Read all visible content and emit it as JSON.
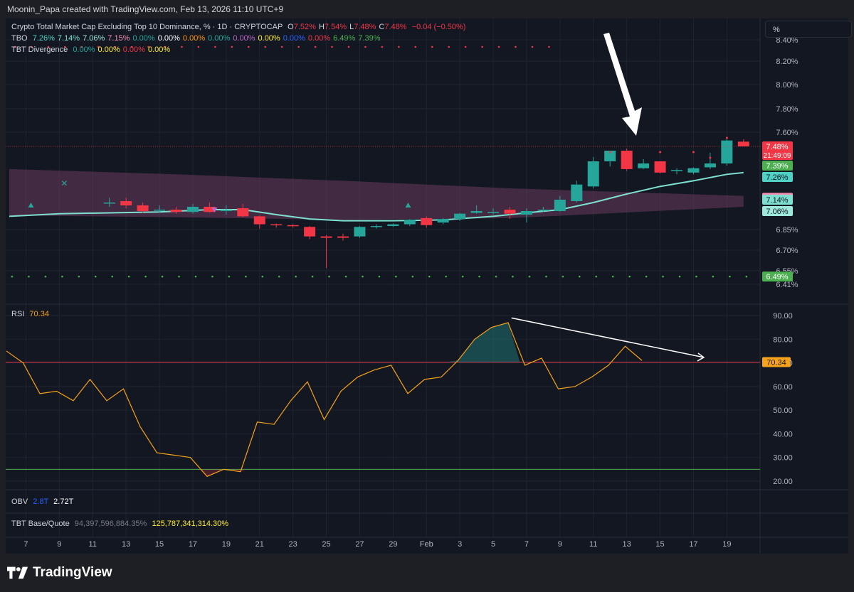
{
  "header": {
    "attribution": "Moonin_Papa created with TradingView.com, Feb 13, 2026 11:10 UTC+9"
  },
  "scale_pill": {
    "label": "%"
  },
  "legend": {
    "main_title": "Crypto Total Market Cap Excluding Top 10 Dominance, % · 1D · CRYPTOCAP",
    "ohlc": [
      {
        "k": "O",
        "v": "7.52%"
      },
      {
        "k": "H",
        "v": "7.54%"
      },
      {
        "k": "L",
        "v": "7.48%"
      },
      {
        "k": "C",
        "v": "7.48%"
      }
    ],
    "change": "−0.04 (−0.50%)",
    "tbo_label": "TBO",
    "tbo_values": [
      {
        "v": "7.26%",
        "color": "#4fd1c5"
      },
      {
        "v": "7.14%",
        "color": "#7ee0d0"
      },
      {
        "v": "7.06%",
        "color": "#9fe8dc"
      },
      {
        "v": "7.15%",
        "color": "#f48fb1"
      },
      {
        "v": "0.00%",
        "color": "#26a69a"
      },
      {
        "v": "0.00%",
        "color": "#ffffff"
      },
      {
        "v": "0.00%",
        "color": "#ff9800"
      },
      {
        "v": "0.00%",
        "color": "#26a69a"
      },
      {
        "v": "0.00%",
        "color": "#ba68c8"
      },
      {
        "v": "0.00%",
        "color": "#ffeb3b"
      },
      {
        "v": "0.00%",
        "color": "#2962ff"
      },
      {
        "v": "0.00%",
        "color": "#f23645"
      },
      {
        "v": "6.49%",
        "color": "#4caf50"
      },
      {
        "v": "7.39%",
        "color": "#4caf50"
      }
    ],
    "div_label": "TBT Divergence",
    "div_values": [
      {
        "v": "0.00%",
        "color": "#26a69a"
      },
      {
        "v": "0.00%",
        "color": "#ffeb3b"
      },
      {
        "v": "0.00%",
        "color": "#f23645"
      },
      {
        "v": "0.00%",
        "color": "#ffeb3b"
      }
    ],
    "rsi_label": "RSI",
    "rsi_value": "70.34",
    "obv_label": "OBV",
    "obv_v1": "2.8T",
    "obv_v2": "2.72T",
    "bq_label": "TBT Base/Quote",
    "bq_v1": "94,397,596,884.35%",
    "bq_v2": "125,787,341,314.30%"
  },
  "colors": {
    "up": "#26a69a",
    "down": "#f23645",
    "rsi": "#f7a21b",
    "rsi_upper": "#f23645",
    "rsi_lower": "#4caf50",
    "fast_ma": "#7ee0d0",
    "band_fill": "#6b3b5e",
    "tbo_line": "#f48fb1"
  },
  "chart_data": [
    {
      "type": "candlestick",
      "title": "Crypto Total Market Cap Excluding Top 10 Dominance, % · 1D · CRYPTOCAP",
      "x_ticks": [
        "7",
        "9",
        "11",
        "13",
        "15",
        "17",
        "19",
        "21",
        "23",
        "25",
        "27",
        "29",
        "Feb",
        "3",
        "5",
        "7",
        "9",
        "11",
        "13",
        "15",
        "17",
        "19"
      ],
      "y_ticks": [
        "6.41%",
        "6.55%",
        "6.70%",
        "6.85%",
        "7.60%",
        "7.80%",
        "8.00%",
        "8.20%",
        "8.40%"
      ],
      "ylim": [
        6.41,
        8.42
      ],
      "price_labels": [
        {
          "text": "7.48%",
          "sub": "21:49:09",
          "value": 7.48,
          "color": "#f23645"
        },
        {
          "text": "7.39%",
          "value": 7.39,
          "color": "#4caf50"
        },
        {
          "text": "7.26%",
          "value": 7.26,
          "color": "#4fd1c5"
        },
        {
          "text": "7.15%",
          "value": 7.15,
          "color": "#f48fb1"
        },
        {
          "text": "7.14%",
          "value": 7.14,
          "color": "#7ee0d0"
        },
        {
          "text": "7.06%",
          "value": 7.06,
          "color": "#9fe8dc"
        },
        {
          "text": "6.49%",
          "value": 6.49,
          "color": "#4caf50"
        }
      ],
      "candles": [
        {
          "d": 6,
          "o": 7.12,
          "h": 7.15,
          "l": 7.09,
          "c": 7.12
        },
        {
          "d": 7,
          "o": 7.13,
          "h": 7.15,
          "l": 7.08,
          "c": 7.1
        },
        {
          "d": 8,
          "o": 7.1,
          "h": 7.12,
          "l": 7.04,
          "c": 7.06
        },
        {
          "d": 9,
          "o": 7.07,
          "h": 7.1,
          "l": 7.04,
          "c": 7.07
        },
        {
          "d": 10,
          "o": 7.07,
          "h": 7.09,
          "l": 7.03,
          "c": 7.05
        },
        {
          "d": 11,
          "o": 7.05,
          "h": 7.11,
          "l": 7.03,
          "c": 7.09
        },
        {
          "d": 12,
          "o": 7.09,
          "h": 7.12,
          "l": 7.04,
          "c": 7.05
        },
        {
          "d": 13,
          "o": 7.06,
          "h": 7.1,
          "l": 7.02,
          "c": 7.07
        },
        {
          "d": 14,
          "o": 7.08,
          "h": 7.11,
          "l": 6.99,
          "c": 7.0
        },
        {
          "d": 15,
          "o": 7.0,
          "h": 7.01,
          "l": 6.86,
          "c": 6.91
        },
        {
          "d": 16,
          "o": 6.91,
          "h": 6.92,
          "l": 6.87,
          "c": 6.9
        },
        {
          "d": 17,
          "o": 6.9,
          "h": 6.91,
          "l": 6.87,
          "c": 6.89
        },
        {
          "d": 18,
          "o": 6.88,
          "h": 6.89,
          "l": 6.78,
          "c": 6.8
        },
        {
          "d": 19,
          "o": 6.8,
          "h": 6.81,
          "l": 6.57,
          "c": 6.79
        },
        {
          "d": 20,
          "o": 6.8,
          "h": 6.82,
          "l": 6.77,
          "c": 6.79
        },
        {
          "d": 21,
          "o": 6.8,
          "h": 6.89,
          "l": 6.79,
          "c": 6.88
        },
        {
          "d": 22,
          "o": 6.89,
          "h": 6.91,
          "l": 6.86,
          "c": 6.89
        },
        {
          "d": 23,
          "o": 6.89,
          "h": 6.92,
          "l": 6.88,
          "c": 6.91
        },
        {
          "d": 24,
          "o": 6.91,
          "h": 6.97,
          "l": 6.89,
          "c": 6.96
        },
        {
          "d": 25,
          "o": 6.98,
          "h": 7.0,
          "l": 6.87,
          "c": 6.9
        },
        {
          "d": 26,
          "o": 6.93,
          "h": 6.98,
          "l": 6.91,
          "c": 6.97
        },
        {
          "d": 27,
          "o": 6.97,
          "h": 7.04,
          "l": 6.95,
          "c": 7.03
        },
        {
          "d": 28,
          "o": 7.04,
          "h": 7.1,
          "l": 7.03,
          "c": 7.06
        },
        {
          "d": 29,
          "o": 7.05,
          "h": 7.08,
          "l": 7.02,
          "c": 7.05
        },
        {
          "d": 30,
          "o": 7.07,
          "h": 7.09,
          "l": 6.97,
          "c": 7.03
        },
        {
          "d": 31,
          "o": 7.02,
          "h": 7.08,
          "l": 6.93,
          "c": 7.06
        },
        {
          "d": 32,
          "o": 7.07,
          "h": 7.09,
          "l": 7.05,
          "c": 7.07
        },
        {
          "d": 33,
          "o": 7.06,
          "h": 7.16,
          "l": 7.05,
          "c": 7.14
        },
        {
          "d": 34,
          "o": 7.13,
          "h": 7.24,
          "l": 7.12,
          "c": 7.22
        },
        {
          "d": 35,
          "o": 7.21,
          "h": 7.43,
          "l": 7.2,
          "c": 7.41
        },
        {
          "d": 36,
          "o": 7.41,
          "h": 7.46,
          "l": 7.38,
          "c": 7.46
        },
        {
          "d": 37,
          "o": 7.46,
          "h": 7.47,
          "l": 7.33,
          "c": 7.35
        },
        {
          "d": 38,
          "o": 7.36,
          "h": 7.42,
          "l": 7.35,
          "c": 7.4
        },
        {
          "d": 39,
          "o": 7.41,
          "h": 7.41,
          "l": 7.3,
          "c": 7.31
        },
        {
          "d": 40,
          "o": 7.34,
          "h": 7.36,
          "l": 7.29,
          "c": 7.34
        },
        {
          "d": 41,
          "o": 7.31,
          "h": 7.37,
          "l": 7.29,
          "c": 7.36
        },
        {
          "d": 42,
          "o": 7.37,
          "h": 7.45,
          "l": 7.35,
          "c": 7.4
        },
        {
          "d": 43,
          "o": 7.4,
          "h": 7.54,
          "l": 7.39,
          "c": 7.53
        },
        {
          "d": 44,
          "o": 7.52,
          "h": 7.54,
          "l": 7.48,
          "c": 7.48
        }
      ],
      "series": [
        {
          "name": "TBO fast",
          "color": "#7ee0d0",
          "values": [
            [
              0,
              7.0
            ],
            [
              3,
              7.03
            ],
            [
              6,
              7.04
            ],
            [
              9,
              7.05
            ],
            [
              12,
              7.07
            ],
            [
              14,
              7.07
            ],
            [
              16,
              7.02
            ],
            [
              18,
              6.97
            ],
            [
              20,
              6.95
            ],
            [
              23,
              6.95
            ],
            [
              26,
              6.96
            ],
            [
              29,
              7.0
            ],
            [
              31,
              7.04
            ],
            [
              33,
              7.07
            ],
            [
              35,
              7.12
            ],
            [
              37,
              7.17
            ],
            [
              39,
              7.21
            ],
            [
              41,
              7.24
            ],
            [
              43,
              7.29
            ],
            [
              44,
              7.31
            ]
          ]
        }
      ],
      "band": {
        "upper": [
          [
            0,
            7.35
          ],
          [
            10,
            7.29
          ],
          [
            20,
            7.24
          ],
          [
            30,
            7.2
          ],
          [
            44,
            7.16
          ]
        ],
        "lower": [
          [
            0,
            7.01
          ],
          [
            10,
            6.99
          ],
          [
            20,
            6.96
          ],
          [
            30,
            6.98
          ],
          [
            44,
            7.09
          ]
        ]
      },
      "dots_top": {
        "value": 8.36,
        "x_from": 0,
        "x_to": 32,
        "color": "#f23645"
      },
      "dots_bottom": {
        "value": 6.49,
        "x_from": 0,
        "x_to": 44,
        "color": "#4caf50"
      }
    },
    {
      "type": "line",
      "title": "RSI",
      "y_ticks": [
        "20.00",
        "30.00",
        "40.00",
        "50.00",
        "60.00",
        "70.00",
        "80.00",
        "90.00"
      ],
      "ylim": [
        16,
        92
      ],
      "upper_line": 70.34,
      "lower_line": 25,
      "last_value_label": "70.34",
      "series": [
        {
          "name": "RSI",
          "color": "#f7a21b",
          "values": [
            75,
            70,
            57,
            58,
            54,
            63,
            54,
            59,
            43,
            32,
            31,
            30,
            22,
            25,
            24,
            45,
            44,
            54,
            62,
            46,
            58,
            64,
            67,
            69,
            57,
            63,
            64,
            71,
            80,
            85,
            87,
            69,
            72,
            59,
            60,
            64,
            69,
            77,
            71
          ]
        }
      ]
    }
  ]
}
